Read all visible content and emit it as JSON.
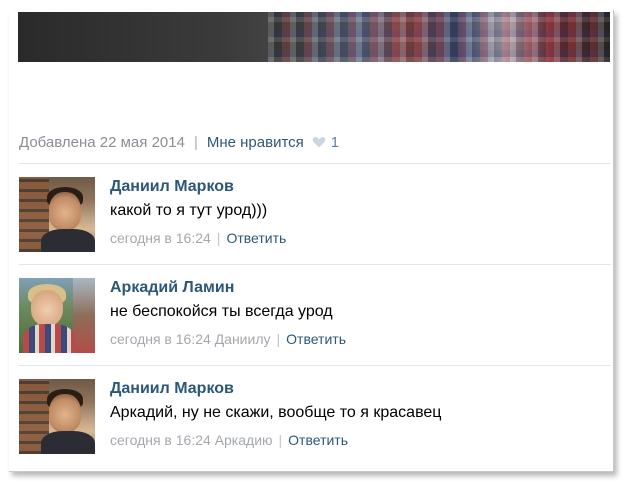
{
  "post": {
    "added_label": "Добавлена 22 мая 2014",
    "separator": "|",
    "like_label": "Мне нравится",
    "like_count": "1",
    "heart_icon": "heart-icon"
  },
  "comments": [
    {
      "author": "Даниил Марков",
      "text": "какой то я тут урод)))",
      "time": "сегодня в 16:24",
      "addressee": "",
      "reply_label": "Ответить"
    },
    {
      "author": "Аркадий Ламин",
      "text": "не беспокойся ты всегда урод",
      "time": "сегодня в 16:24",
      "addressee": "Даниилу",
      "reply_label": "Ответить"
    },
    {
      "author": "Даниил Марков",
      "text": "Аркадий, ну не скажи, вообще то я красавец",
      "time": "сегодня в 16:24",
      "addressee": "Аркадию",
      "reply_label": "Ответить"
    }
  ],
  "colors": {
    "link": "#2b587a",
    "meta": "#a4a8ad",
    "divider": "#e4e7ea",
    "heart": "#c8d6e6"
  }
}
